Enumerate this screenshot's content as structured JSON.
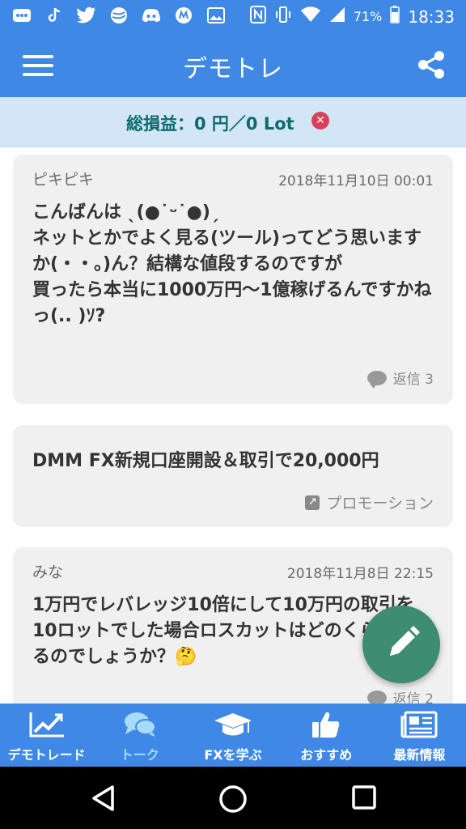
{
  "status_bar": {
    "battery_percent": "71%",
    "time": "18:33",
    "left_icons": [
      "mail-icon",
      "tiktok-icon",
      "twitter-icon",
      "globe-icon",
      "discord-icon",
      "m-app-icon",
      "image-icon"
    ]
  },
  "app_bar": {
    "title": "デモトレ"
  },
  "summary": {
    "text": "総損益：0 円／0 Lot"
  },
  "posts": [
    {
      "author": "ピキピキ",
      "date": "2018年11月10日 00:01",
      "body": "こんばんは ˎ(●˙ᵕ˙●)ˏ\nネットとかでよく見る(ツール)ってどう思いますか(・・。)ん？結構な値段するのですが\n買ったら本当に1000万円〜1億稼げるんですかねっ(.. )ｿ?",
      "reply_label": "返信 3"
    },
    {
      "author": "みな",
      "date": "2018年11月8日 22:15",
      "body": "1万円でレバレッジ10倍にして10万円の取引を10ロットでした場合ロスカットはどのくらいでなるのでしょうか？🤔",
      "reply_label": "返信 2"
    }
  ],
  "promo": {
    "title": "DMM FX新規口座開設＆取引で20,000円",
    "label": "プロモーション"
  },
  "bottom_nav": [
    {
      "label": "デモトレード",
      "icon": "chart-icon"
    },
    {
      "label": "トーク",
      "icon": "chat-icon"
    },
    {
      "label": "FXを学ぶ",
      "icon": "graduation-cap-icon"
    },
    {
      "label": "おすすめ",
      "icon": "thumbs-up-icon"
    },
    {
      "label": "最新情報",
      "icon": "newspaper-icon"
    }
  ],
  "colors": {
    "primary": "#3f88e6",
    "summary_bg": "#d3e6f8",
    "summary_text": "#0d6b6f",
    "fab": "#3e8c72",
    "active_tab": "#a7dbff",
    "close_badge": "#d9415a"
  }
}
